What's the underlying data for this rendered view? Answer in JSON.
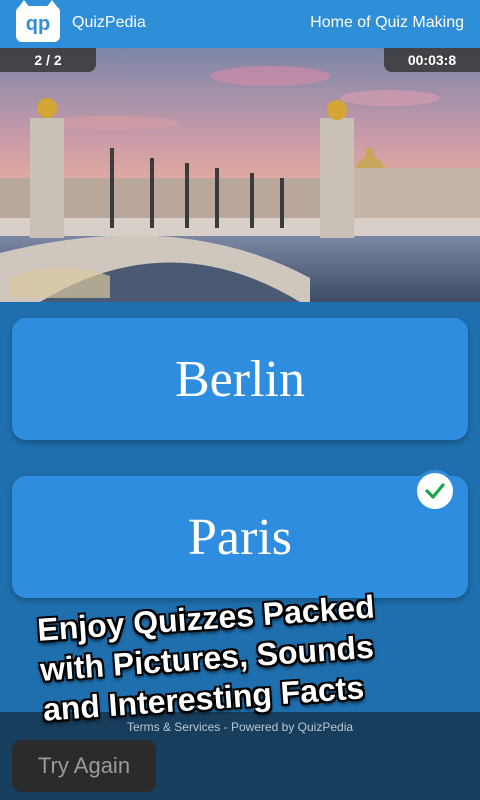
{
  "header": {
    "logo_text": "qp",
    "brand": "QuizPedia",
    "tagline": "Home of Quiz Making"
  },
  "quiz": {
    "counter": "2 / 2",
    "timer": "00:03:8"
  },
  "answers": [
    {
      "label": "Berlin"
    },
    {
      "label": "Paris",
      "selected_icon": "check-icon"
    }
  ],
  "footer": {
    "terms_text": "Terms & Services - Powered by QuizPedia",
    "try_again_label": "Try Again"
  },
  "promo": {
    "line1": "Enjoy Quizzes Packed",
    "line2": "with Pictures, Sounds",
    "line3": "and Interesting Facts"
  }
}
